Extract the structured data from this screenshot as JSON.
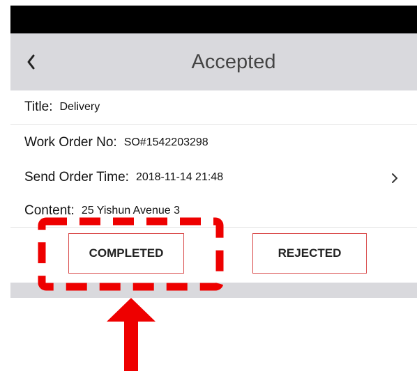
{
  "header": {
    "back_icon": "chevron-left-icon",
    "title": "Accepted"
  },
  "details": {
    "title_label": "Title:",
    "title_value": "Delivery",
    "work_order_label": "Work Order No:",
    "work_order_value": "SO#1542203298",
    "send_time_label": "Send Order Time:",
    "send_time_value": "2018-11-14 21:48",
    "send_time_icon": "chevron-right-icon",
    "content_label": "Content:",
    "content_value": "25 Yishun Avenue 3"
  },
  "actions": {
    "completed_label": "COMPLETED",
    "rejected_label": "REJECTED"
  },
  "colors": {
    "header_bg": "#d9d9dd",
    "button_border": "#d94a4a",
    "annotation": "#ee0000"
  }
}
